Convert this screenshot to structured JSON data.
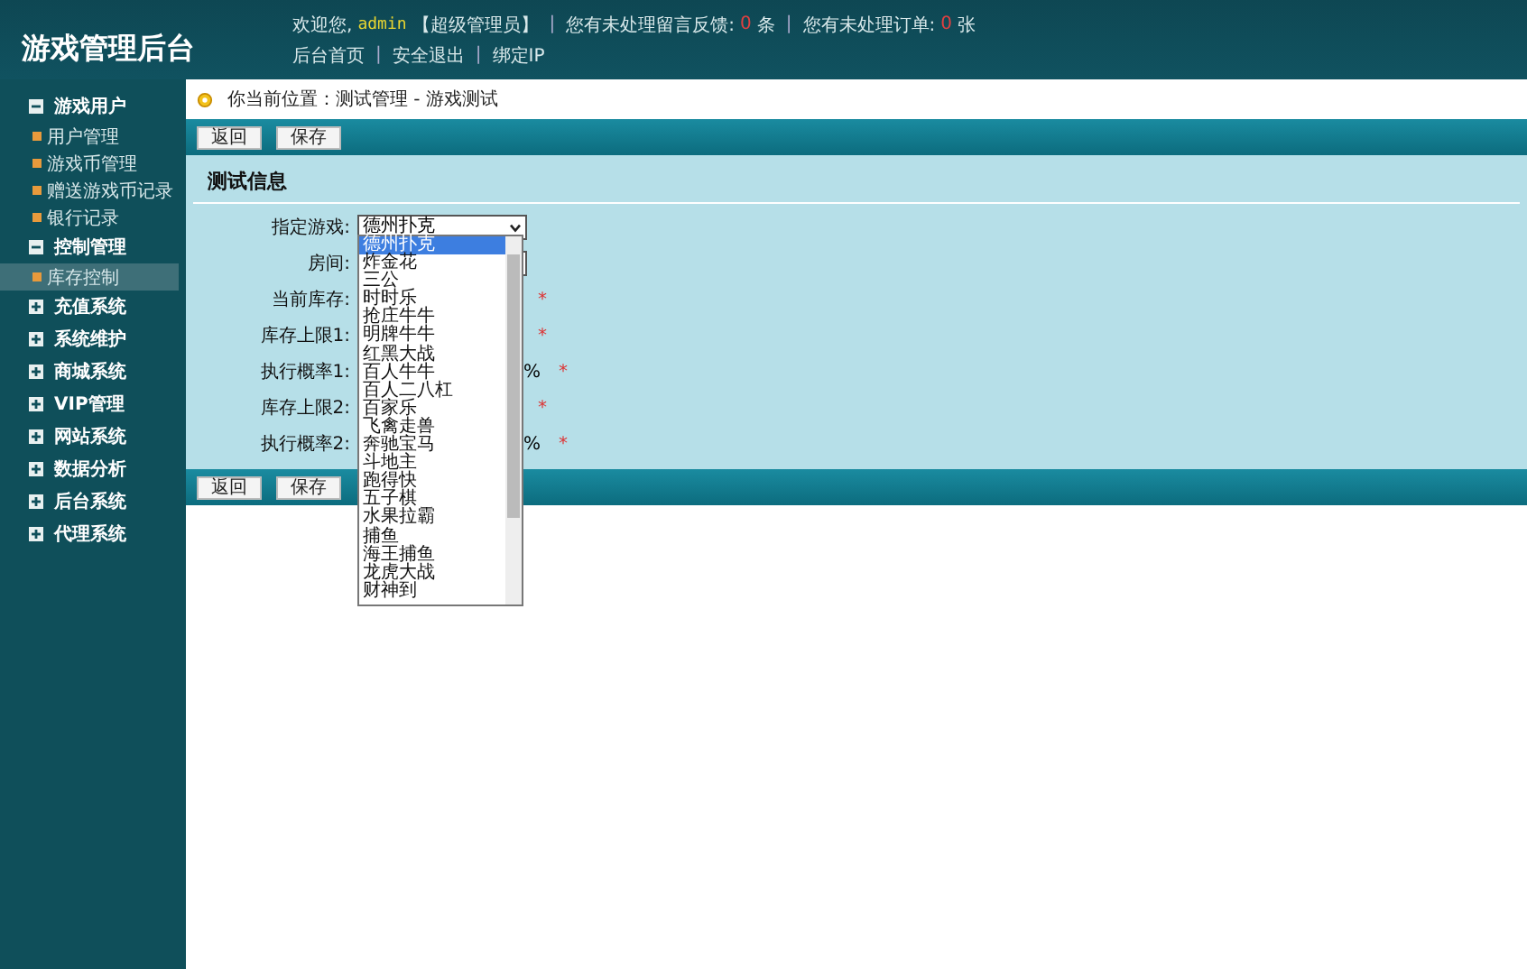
{
  "header": {
    "title": "游戏管理后台",
    "welcome": "欢迎您,",
    "user": "admin",
    "role": "【超级管理员】",
    "feedback_label": "您有未处理留言反馈:",
    "feedback_count": "0",
    "feedback_unit": "条",
    "orders_label": "您有未处理订单:",
    "orders_count": "0",
    "orders_unit": "张",
    "links": [
      "后台首页",
      "安全退出",
      "绑定IP"
    ],
    "separator": "|"
  },
  "sidebar": {
    "groups": [
      {
        "label": "游戏用户",
        "expanded": true,
        "children": [
          {
            "label": "用户管理",
            "selected": false
          },
          {
            "label": "游戏币管理",
            "selected": false
          },
          {
            "label": "赠送游戏币记录",
            "selected": false
          },
          {
            "label": "银行记录",
            "selected": false
          }
        ]
      },
      {
        "label": "控制管理",
        "expanded": true,
        "children": [
          {
            "label": "库存控制",
            "selected": true
          }
        ]
      },
      {
        "label": "充值系统",
        "expanded": false
      },
      {
        "label": "系统维护",
        "expanded": false
      },
      {
        "label": "商城系统",
        "expanded": false
      },
      {
        "label": "VIP管理",
        "expanded": false
      },
      {
        "label": "网站系统",
        "expanded": false
      },
      {
        "label": "数据分析",
        "expanded": false
      },
      {
        "label": "后台系统",
        "expanded": false
      },
      {
        "label": "代理系统",
        "expanded": false
      }
    ]
  },
  "breadcrumb": "你当前位置：测试管理 - 游戏测试",
  "toolbar_buttons": [
    "返回",
    "保存"
  ],
  "form": {
    "title": "测试信息",
    "fields": [
      {
        "label": "指定游戏:",
        "kind": "select",
        "value": "德州扑克"
      },
      {
        "label": "房间:",
        "kind": "select"
      },
      {
        "label": "当前库存:",
        "kind": "input",
        "required_mark": "*"
      },
      {
        "label": "库存上限1:",
        "kind": "input",
        "required_mark": "*"
      },
      {
        "label": "执行概率1:",
        "kind": "input",
        "suffix": "%",
        "required_mark": "*"
      },
      {
        "label": "库存上限2:",
        "kind": "input",
        "required_mark": "*"
      },
      {
        "label": "执行概率2:",
        "kind": "input",
        "suffix": "%",
        "required_mark": "*"
      }
    ]
  },
  "dropdown_options": [
    {
      "label": "德州扑克",
      "selected": true
    },
    {
      "label": "炸金花",
      "selected": false
    },
    {
      "label": "三公",
      "selected": false
    },
    {
      "label": "时时乐",
      "selected": false
    },
    {
      "label": "抢庄牛牛",
      "selected": false
    },
    {
      "label": "明牌牛牛",
      "selected": false
    },
    {
      "label": "红黑大战",
      "selected": false
    },
    {
      "label": "百人牛牛",
      "selected": false
    },
    {
      "label": "百人二八杠",
      "selected": false
    },
    {
      "label": "百家乐",
      "selected": false
    },
    {
      "label": "飞禽走兽",
      "selected": false
    },
    {
      "label": "奔驰宝马",
      "selected": false
    },
    {
      "label": "斗地主",
      "selected": false
    },
    {
      "label": "跑得快",
      "selected": false
    },
    {
      "label": "五子棋",
      "selected": false
    },
    {
      "label": "水果拉霸",
      "selected": false
    },
    {
      "label": "捕鱼",
      "selected": false
    },
    {
      "label": "海王捕鱼",
      "selected": false
    },
    {
      "label": "龙虎大战",
      "selected": false
    },
    {
      "label": "财神到",
      "selected": false
    }
  ],
  "bottom_buttons": [
    "返回",
    "保存"
  ]
}
